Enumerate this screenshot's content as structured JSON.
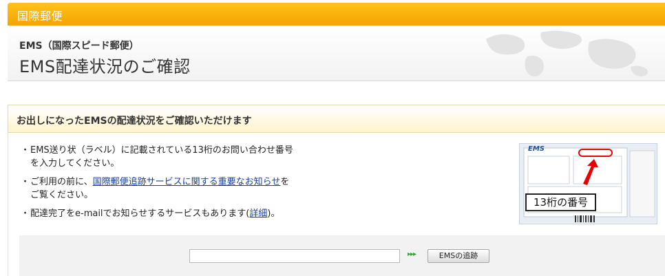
{
  "topbar": {
    "title": "国際郵便"
  },
  "header": {
    "subtitle": "EMS（国際スピード郵便）",
    "title": "EMS配達状況のご確認"
  },
  "section": {
    "title": "お出しになったEMSの配達状況をご確認いただけます"
  },
  "bullets": {
    "b1_line1": "EMS送り状（ラベル）に記載されている13桁のお問い合わせ番号",
    "b1_line2": "を入力してください。",
    "b2_pre": "ご利用の前に、",
    "b2_link": "国際郵便追跡サービスに関する重要なお知らせ",
    "b2_post": "を",
    "b2_line2": "ご覧ください。",
    "b3_pre": "配達完了をe-mailでお知らせするサービスもあります(",
    "b3_link": "詳細",
    "b3_post": ")。"
  },
  "image": {
    "label": "13桁の番号",
    "logo": "EMS"
  },
  "search": {
    "input_value": "",
    "arrows": "▸▸▸",
    "button_label": "EMSの追跡"
  },
  "colors": {
    "accent": "#f5a300",
    "link": "#1a3fa0",
    "arrow": "#3aa23a"
  }
}
